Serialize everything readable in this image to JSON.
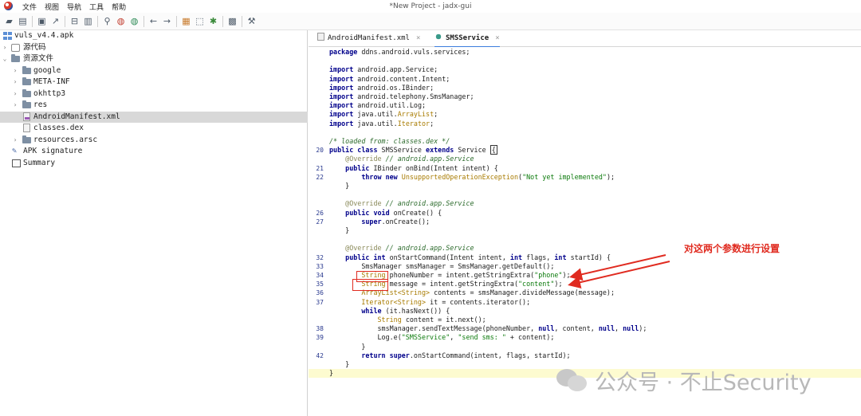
{
  "window": {
    "title": "*New Project - jadx-gui",
    "menu": [
      "文件",
      "视图",
      "导航",
      "工具",
      "帮助"
    ]
  },
  "toolbar": {
    "icons": [
      "open-icon",
      "add-files-icon",
      "save-icon",
      "export-icon",
      "sync-tree-icon",
      "flatten-packages-icon",
      "search-icon",
      "find-class-icon",
      "find-usage-icon",
      "back-icon",
      "forward-icon",
      "decompile-all-icon",
      "select-icon",
      "debug-icon",
      "log-icon",
      "preferences-icon"
    ]
  },
  "tree": {
    "nodes": [
      {
        "label": "vuls_v4.4.apk",
        "icon": "apk-icon",
        "depth": 0,
        "arrow": ""
      },
      {
        "label": "源代码",
        "icon": "package-icon",
        "depth": 0,
        "arrow": "›"
      },
      {
        "label": "资源文件",
        "icon": "folder-icon",
        "depth": 0,
        "arrow": "⌄"
      },
      {
        "label": "google",
        "icon": "folder-icon",
        "depth": 1,
        "arrow": "›"
      },
      {
        "label": "META-INF",
        "icon": "folder-icon",
        "depth": 1,
        "arrow": "›"
      },
      {
        "label": "okhttp3",
        "icon": "folder-icon",
        "depth": 1,
        "arrow": "›"
      },
      {
        "label": "res",
        "icon": "folder-icon",
        "depth": 1,
        "arrow": "›"
      },
      {
        "label": "AndroidManifest.xml",
        "icon": "xml-file-icon",
        "depth": 1,
        "arrow": "",
        "selected": true
      },
      {
        "label": "classes.dex",
        "icon": "file-icon",
        "depth": 1,
        "arrow": ""
      },
      {
        "label": "resources.arsc",
        "icon": "folder-icon",
        "depth": 1,
        "arrow": "›"
      },
      {
        "label": "APK signature",
        "icon": "signature-icon",
        "depth": 0,
        "arrow": ""
      },
      {
        "label": "Summary",
        "icon": "summary-icon",
        "depth": 0,
        "arrow": ""
      }
    ]
  },
  "tabs": [
    {
      "label": "AndroidManifest.xml",
      "close": "×",
      "active": false
    },
    {
      "label": "SMSService",
      "close": "×",
      "active": true
    }
  ],
  "code": {
    "lines": [
      {
        "n": "",
        "html": "<span class='k'>package</span> ddns.android.vuls.services;"
      },
      {
        "n": "",
        "html": ""
      },
      {
        "n": "",
        "html": "<span class='k'>import</span> android.app.Service;"
      },
      {
        "n": "",
        "html": "<span class='k'>import</span> android.content.Intent;"
      },
      {
        "n": "",
        "html": "<span class='k'>import</span> android.os.IBinder;"
      },
      {
        "n": "",
        "html": "<span class='k'>import</span> android.telephony.SmsManager;"
      },
      {
        "n": "",
        "html": "<span class='k'>import</span> android.util.Log;"
      },
      {
        "n": "",
        "html": "<span class='k'>import</span> java.util.<span class='t'>ArrayList</span>;"
      },
      {
        "n": "",
        "html": "<span class='k'>import</span> java.util.<span class='t'>Iterator</span>;"
      },
      {
        "n": "",
        "html": ""
      },
      {
        "n": "",
        "html": "<span class='c'>/* loaded from: classes.dex */</span>"
      },
      {
        "n": "20",
        "html": "<span class='k'>public class</span> SMSService <span class='k'>extends</span> Service <span class='br'>{</span>"
      },
      {
        "n": "",
        "html": "    <span class='a'>@Override</span> <span class='c'>// android.app.Service</span>"
      },
      {
        "n": "21",
        "html": "    <span class='k'>public</span> IBinder onBind(Intent intent) {"
      },
      {
        "n": "22",
        "html": "        <span class='k'>throw new</span> <span class='t'>UnsupportedOperationException</span>(<span class='s'>\"Not yet implemented\"</span>);"
      },
      {
        "n": "",
        "html": "    }"
      },
      {
        "n": "",
        "html": ""
      },
      {
        "n": "",
        "html": "    <span class='a'>@Override</span> <span class='c'>// android.app.Service</span>"
      },
      {
        "n": "26",
        "html": "    <span class='k'>public void</span> onCreate() {"
      },
      {
        "n": "27",
        "html": "        <span class='k'>super</span>.onCreate();"
      },
      {
        "n": "",
        "html": "    }"
      },
      {
        "n": "",
        "html": ""
      },
      {
        "n": "",
        "html": "    <span class='a'>@Override</span> <span class='c'>// android.app.Service</span>"
      },
      {
        "n": "32",
        "html": "    <span class='k'>public int</span> onStartCommand(Intent intent, <span class='k'>int</span> flags, <span class='k'>int</span> startId) {"
      },
      {
        "n": "33",
        "html": "        SmsManager smsManager = SmsManager.getDefault();"
      },
      {
        "n": "34",
        "html": "        <span class='t'>String</span> phoneNumber = intent.getStringExtra(<span class='s'>\"phone\"</span>);"
      },
      {
        "n": "35",
        "html": "        <span class='t'>String</span> message = intent.getStringExtra(<span class='s'>\"content\"</span>);"
      },
      {
        "n": "36",
        "html": "        <span class='t'>ArrayList&lt;String&gt;</span> contents = smsManager.divideMessage(message);"
      },
      {
        "n": "37",
        "html": "        <span class='t'>Iterator&lt;String&gt;</span> it = contents.iterator();"
      },
      {
        "n": "",
        "html": "        <span class='k'>while</span> (it.hasNext()) {"
      },
      {
        "n": "",
        "html": "            <span class='t'>String</span> content = it.next();"
      },
      {
        "n": "38",
        "html": "            smsManager.sendTextMessage(phoneNumber, <span class='k'>null</span>, content, <span class='k'>null</span>, <span class='k'>null</span>);"
      },
      {
        "n": "39",
        "html": "            Log.e(<span class='s'>\"SMSService\"</span>, <span class='s'>\"send sms: \"</span> + content);"
      },
      {
        "n": "",
        "html": "        }"
      },
      {
        "n": "42",
        "html": "        <span class='k'>return super</span>.onStartCommand(intent, flags, startId);"
      },
      {
        "n": "",
        "html": "    }"
      },
      {
        "n": "",
        "html": "}",
        "highlight": true
      }
    ]
  },
  "annotation": {
    "text": "对这两个参数进行设置",
    "color": "#e02b20"
  },
  "watermark": {
    "text": "公众号 · 不止Security"
  }
}
